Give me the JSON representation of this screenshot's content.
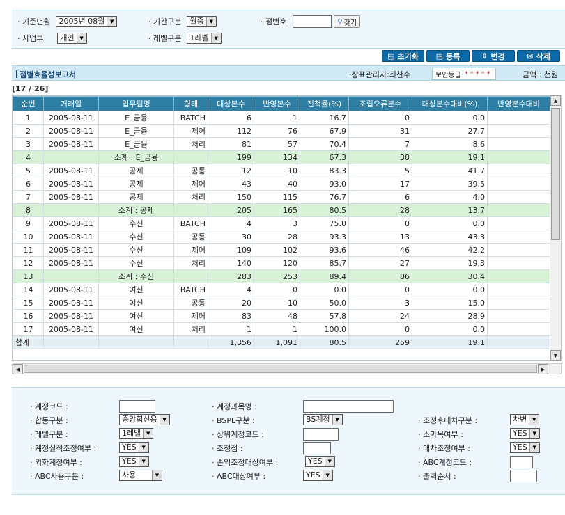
{
  "search": {
    "base_month_label": "· 기준년월",
    "base_month_value": "2005년 08월",
    "period_label": "· 기간구분",
    "period_value": "월중",
    "branch_label": "· 점번호",
    "branch_value": "",
    "find_button": "찾기",
    "division_label": "· 사업부",
    "division_value": "개인",
    "level_label": "· 레벨구분",
    "level_value": "1레벨"
  },
  "actions": {
    "reset": "초기화",
    "register": "등록",
    "change": "변경",
    "delete": "삭제"
  },
  "report": {
    "title": "점별효율성보고서",
    "manager": "·장표관리자:최찬수",
    "security_label": "보안등급",
    "security_stars": "*****",
    "amount_unit": "금액 : 천원",
    "record_count": "[17 / 26]"
  },
  "table": {
    "columns": [
      "순번",
      "거래일",
      "업무팀명",
      "형태",
      "대상본수",
      "반영본수",
      "진척률(%)",
      "조립오류본수",
      "대상본수대비(%)",
      "반영본수대비"
    ],
    "rows": [
      {
        "type": "data",
        "cells": [
          "1",
          "2005-08-11",
          "E_금융",
          "BATCH",
          "6",
          "1",
          "16.7",
          "0",
          "0.0",
          ""
        ]
      },
      {
        "type": "data",
        "cells": [
          "2",
          "2005-08-11",
          "E_금융",
          "제어",
          "112",
          "76",
          "67.9",
          "31",
          "27.7",
          ""
        ]
      },
      {
        "type": "data",
        "cells": [
          "3",
          "2005-08-11",
          "E_금융",
          "처리",
          "81",
          "57",
          "70.4",
          "7",
          "8.6",
          ""
        ]
      },
      {
        "type": "sub",
        "cells": [
          "4",
          "",
          "소계 : E_금융",
          "",
          "199",
          "134",
          "67.3",
          "38",
          "19.1",
          ""
        ]
      },
      {
        "type": "data",
        "cells": [
          "5",
          "2005-08-11",
          "공제",
          "공통",
          "12",
          "10",
          "83.3",
          "5",
          "41.7",
          ""
        ]
      },
      {
        "type": "data",
        "cells": [
          "6",
          "2005-08-11",
          "공제",
          "제어",
          "43",
          "40",
          "93.0",
          "17",
          "39.5",
          ""
        ]
      },
      {
        "type": "data",
        "cells": [
          "7",
          "2005-08-11",
          "공제",
          "처리",
          "150",
          "115",
          "76.7",
          "6",
          "4.0",
          ""
        ]
      },
      {
        "type": "sub",
        "cells": [
          "8",
          "",
          "소계 : 공제",
          "",
          "205",
          "165",
          "80.5",
          "28",
          "13.7",
          ""
        ]
      },
      {
        "type": "data",
        "cells": [
          "9",
          "2005-08-11",
          "수신",
          "BATCH",
          "4",
          "3",
          "75.0",
          "0",
          "0.0",
          ""
        ]
      },
      {
        "type": "data",
        "cells": [
          "10",
          "2005-08-11",
          "수신",
          "공통",
          "30",
          "28",
          "93.3",
          "13",
          "43.3",
          ""
        ]
      },
      {
        "type": "data",
        "cells": [
          "11",
          "2005-08-11",
          "수신",
          "제어",
          "109",
          "102",
          "93.6",
          "46",
          "42.2",
          ""
        ]
      },
      {
        "type": "data",
        "cells": [
          "12",
          "2005-08-11",
          "수신",
          "처리",
          "140",
          "120",
          "85.7",
          "27",
          "19.3",
          ""
        ]
      },
      {
        "type": "sub",
        "cells": [
          "13",
          "",
          "소계 : 수신",
          "",
          "283",
          "253",
          "89.4",
          "86",
          "30.4",
          ""
        ]
      },
      {
        "type": "data",
        "cells": [
          "14",
          "2005-08-11",
          "여신",
          "BATCH",
          "4",
          "0",
          "0.0",
          "0",
          "0.0",
          ""
        ]
      },
      {
        "type": "data",
        "cells": [
          "15",
          "2005-08-11",
          "여신",
          "공통",
          "20",
          "10",
          "50.0",
          "3",
          "15.0",
          ""
        ]
      },
      {
        "type": "data",
        "cells": [
          "16",
          "2005-08-11",
          "여신",
          "제어",
          "83",
          "48",
          "57.8",
          "24",
          "28.9",
          ""
        ]
      },
      {
        "type": "data",
        "cells": [
          "17",
          "2005-08-11",
          "여신",
          "처리",
          "1",
          "1",
          "100.0",
          "0",
          "0.0",
          ""
        ]
      },
      {
        "type": "tot",
        "cells": [
          "합계",
          "",
          "",
          "",
          "1,356",
          "1,091",
          "80.5",
          "259",
          "19.1",
          ""
        ]
      }
    ]
  },
  "detail": {
    "acct_code_label": "· 계정코드 :",
    "acct_code_value": "",
    "acct_subject_label": "· 계정과목명 :",
    "acct_subject_value": "",
    "merge_label": "· 합동구분 :",
    "merge_value": "중앙회신용",
    "bspl_label": "· BSPL구분 :",
    "bspl_value": "BS계정",
    "adj_dc_label": "· 조정후대차구분 :",
    "adj_dc_value": "차변",
    "level_label": "· 레벨구분 :",
    "level_value": "1레벨",
    "parent_code_label": "· 상위계정코드 :",
    "parent_code_value": "",
    "sub_subject_label": "· 소과목여부 :",
    "sub_subject_value": "YES",
    "acct_adj_label": "· 계정실적조정여부 :",
    "acct_adj_value": "YES",
    "adj_point_label": "· 조정점 :",
    "adj_point_value": "",
    "dc_adj_label": "· 대차조정여부 :",
    "dc_adj_value": "YES",
    "fx_label": "· 외화계정여부 :",
    "fx_value": "YES",
    "pl_adj_label": "· 손익조정대상여부 :",
    "pl_adj_value": "YES",
    "abc_code_label": "· ABC계정코드 :",
    "abc_code_value": "",
    "abc_use_label": "· ABC사용구분 :",
    "abc_use_value": "사용",
    "abc_target_label": "· ABC대상여부 :",
    "abc_target_value": "YES",
    "print_order_label": "· 출력순서 :",
    "print_order_value": ""
  }
}
